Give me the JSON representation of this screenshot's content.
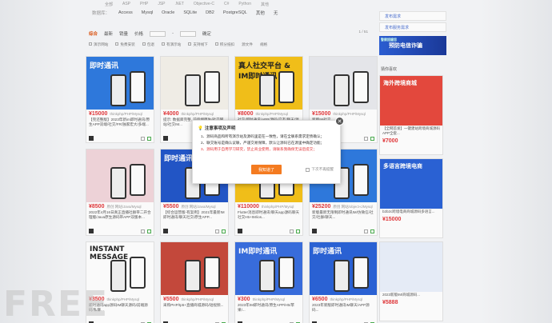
{
  "filter_top": [
    "全部",
    "ASP",
    "PHP",
    "JSP",
    ".NET",
    "Objective-C",
    "C#",
    "Python",
    "其他"
  ],
  "database_filter": {
    "label": "数据库：",
    "items": [
      "Access",
      "Mysql",
      "Oracle",
      "SQLite",
      "DB2",
      "PostgreSQL",
      "其他",
      "无"
    ]
  },
  "sort_bar": {
    "items": [
      "综合",
      "最新",
      "销量",
      "价格"
    ],
    "price_sep": "-",
    "confirm": "确定",
    "pager": "1 / 51"
  },
  "options": [
    "演示网站",
    "免费安装",
    "包退",
    "有演示站",
    "支持线下",
    "积分抵扣",
    "源文件",
    "规格"
  ],
  "cards": [
    {
      "title": "即时通讯",
      "price": "¥15000",
      "lang": "thinkphp/PHP/Mysql",
      "desc": "【完还整版】2023年新im即时通讯/原生APP双端/社交/FR/独家宏大/多端...",
      "bg": "#2f7be0"
    },
    {
      "title": "",
      "price": "¥4000",
      "lang": "thinkphp/PHP/Mysql",
      "desc": "提示: 数据库完整, 前后端原生/社交网站/社交IM...",
      "bg": "#f4f1ea"
    },
    {
      "title": "真人社交平台 & IM即时通讯",
      "price": "¥8000",
      "lang": "thinkphp/PHP/Mysql",
      "desc": "社交/即时通讯/APP/源码/交友/聊天/源码...",
      "bg": "#f5c21a"
    },
    {
      "title": "",
      "price": "¥15000",
      "lang": "thinkphp/PHP/Mysql",
      "desc": "新版IM社交...",
      "bg": "#e9eaee"
    },
    {
      "title": "",
      "price": "¥8500",
      "lang": "原创 网站/Java/Mysql",
      "desc": "2022年4月16日真正直播社群带二开合理版/Java原生源码带APP双版本...",
      "bg": "#f2d7dc"
    },
    {
      "title": "即时通讯",
      "price": "¥5500",
      "lang": "原创 网站/Java/Mysql",
      "desc": "【综合运营版-有案例】2021年最新IM即时通讯/聊天社交/原生APP...",
      "bg": "#2357c9"
    },
    {
      "title": "",
      "price": "¥110000",
      "lang": "thinkphp/PHP/Mysql",
      "desc": "Flutter消息即时通讯/聊天app源码聊天社交H5+IM/ios...",
      "bg": "#f5c21a"
    },
    {
      "title": "",
      "price": "¥25200",
      "lang": "原创 网站/object-c/Mysql",
      "desc": "新版最新无限制即时通讯IM/仿微信/社交/社群/聊天...",
      "bg": "#2f7be0"
    },
    {
      "title": "INSTANT MESSAGE",
      "price": "¥3500",
      "lang": "thinkphp/PHP/Mysql",
      "desc": "即时通讯app源码IM聊天源码/前端源码/私聊...",
      "bg": "#ffffff"
    },
    {
      "title": "",
      "price": "¥5500",
      "lang": "thinkphp/PHP/Mysql",
      "desc": "采购PHP/tp5+直播商城源码/短视频...",
      "bg": "#c74a3d"
    },
    {
      "title": "IM即时通讯",
      "price": "¥300",
      "lang": "thinkphp/PHP/Mysql",
      "desc": "2023年IM即时通讯/原生APP/H5/苹果/...",
      "bg": "#3a6fe0"
    },
    {
      "title": "即时通讯",
      "price": "¥6500",
      "lang": "thinkphp/PHP/Mysql",
      "desc": "2023年新版即时通讯IM聊天/APP源码...",
      "bg": "#2b63d8"
    }
  ],
  "sidebar": {
    "post_demand": "发布需求",
    "post_service": "发布服务需求",
    "banner_title": "预防电信诈骗",
    "banner_sub": "警察提醒您",
    "rec_title": "猜你喜欢",
    "rec_cards": [
      {
        "desc": "【全网首发】一键建站跨境商城源码APP全套...",
        "price": "¥7000",
        "title": "海外跨境商城"
      },
      {
        "desc": "b2b2c跨境电商商城源码多语言...",
        "price": "¥15000",
        "title": "多语言跨境电商"
      },
      {
        "desc": "2023新版IM/商城源码...",
        "price": "¥5888",
        "title": ""
      }
    ]
  },
  "modal": {
    "title": "注意事项及声明",
    "lines": [
      "1、源码商品和所有演示站及源码里是在一致性，请在全联系需求定债确认；",
      "2、联交账号是确认议联，严谨交易保障，默认让源码已在源里中确定功能；",
      "3、源码用于自用学习研究，禁止商业使用，请联系我确保无误后提交；"
    ],
    "red_line": "3、源码用于自用学习研究，禁止商业使用，请联系我确保无误后提交；",
    "button": "我知道了",
    "checkbox": "下次不再提醒",
    "close": "✕"
  },
  "watermark": "FREE"
}
